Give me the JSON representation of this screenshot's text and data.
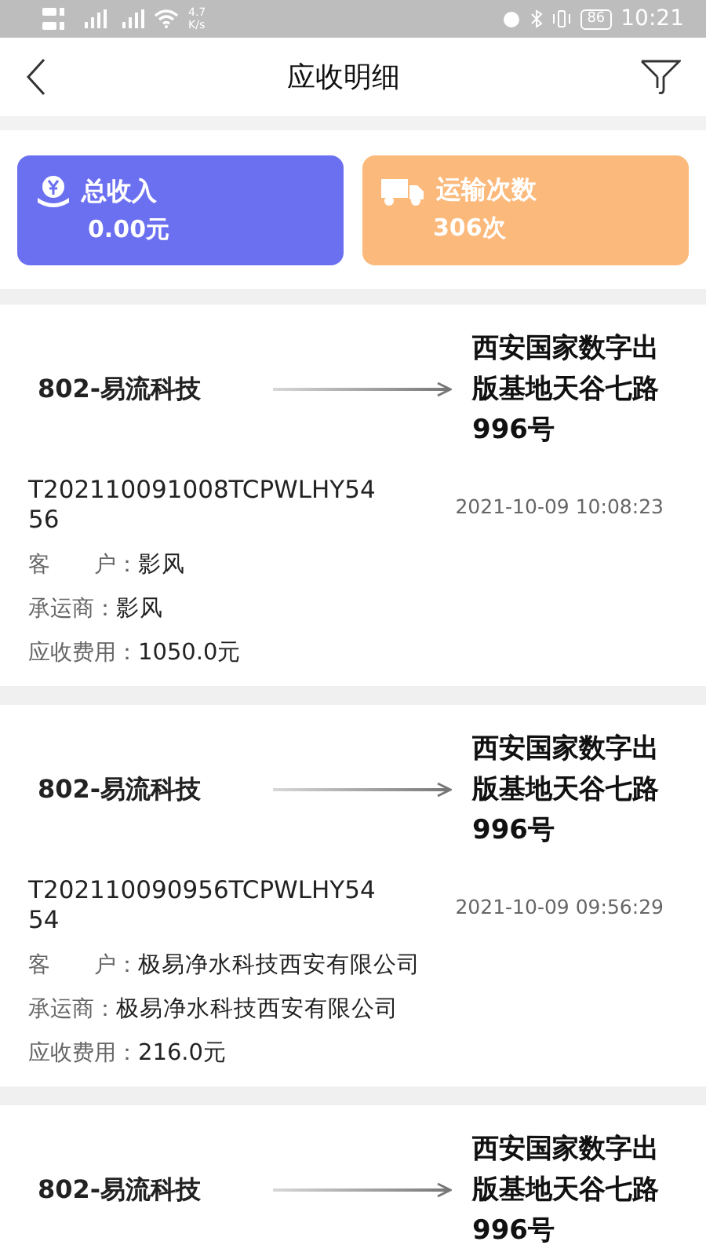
{
  "status_bar": {
    "speed": "4.7",
    "speed_unit": "K/s",
    "battery": "86",
    "time": "10:21"
  },
  "header": {
    "title": "应收明细"
  },
  "summary": [
    {
      "kind": "income",
      "label": "总收入",
      "value": "0.00元",
      "color": "#6b70f0"
    },
    {
      "kind": "trips",
      "label": "运输次数",
      "value": "306次",
      "color": "#fbb97b"
    }
  ],
  "records": [
    {
      "from": "802-易流科技",
      "to": "西安国家数字出版基地天谷七路996号",
      "order_no": "T202110091008TCPWLHY5456",
      "time": "2021-10-09 10:08:23",
      "fields": [
        {
          "label": "客　　户：",
          "value": "影风"
        },
        {
          "label": "承运商：",
          "value": "影风"
        },
        {
          "label": "应收费用：",
          "value": "1050.0元"
        }
      ]
    },
    {
      "from": "802-易流科技",
      "to": "西安国家数字出版基地天谷七路996号",
      "order_no": "T202110090956TCPWLHY5454",
      "time": "2021-10-09 09:56:29",
      "fields": [
        {
          "label": "客　　户：",
          "value": "极易净水科技西安有限公司"
        },
        {
          "label": "承运商：",
          "value": "极易净水科技西安有限公司"
        },
        {
          "label": "应收费用：",
          "value": "216.0元"
        }
      ]
    },
    {
      "from": "802-易流科技",
      "to": "西安国家数字出版基地天谷七路996号"
    }
  ]
}
